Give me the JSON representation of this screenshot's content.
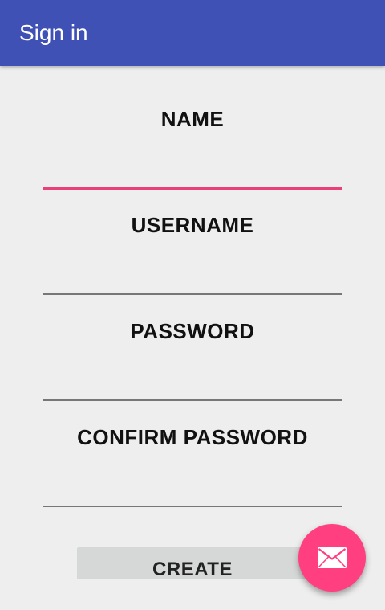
{
  "app_bar": {
    "title": "Sign in"
  },
  "form": {
    "fields": [
      {
        "label": "NAME",
        "value": "",
        "focused": true
      },
      {
        "label": "USERNAME",
        "value": "",
        "focused": false
      },
      {
        "label": "PASSWORD",
        "value": "",
        "focused": false
      },
      {
        "label": "CONFIRM PASSWORD",
        "value": "",
        "focused": false
      }
    ],
    "create_label": "CREATE"
  },
  "fab": {
    "icon": "mail-icon",
    "color": "#ff3f80"
  },
  "colors": {
    "primary": "#3f51b5",
    "accent": "#ff3f80",
    "focus_underline": "#e94079",
    "background": "#eeeeee"
  }
}
